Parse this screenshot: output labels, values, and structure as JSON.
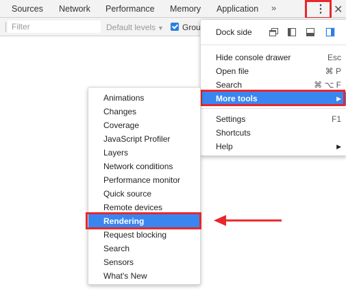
{
  "tabs": [
    {
      "label": "Sources"
    },
    {
      "label": "Network"
    },
    {
      "label": "Performance"
    },
    {
      "label": "Memory"
    },
    {
      "label": "Application"
    }
  ],
  "tab_overflow": "»",
  "kebab_glyph": "⋮",
  "close_glyph": "✕",
  "toolbar": {
    "filter_placeholder": "Filter",
    "filter_value": "",
    "levels_label": "Default levels",
    "levels_arrow": "▼",
    "group_label": "Grou",
    "group_checked": true
  },
  "menu": {
    "dock_side_label": "Dock side",
    "items": [
      {
        "label": "Hide console drawer",
        "shortcut": "Esc"
      },
      {
        "label": "Open file",
        "shortcut": "⌘ P"
      },
      {
        "label": "Search",
        "shortcut": "⌘ ⌥ F"
      },
      {
        "label": "More tools",
        "arrow": "▶"
      },
      {
        "label": "Settings",
        "shortcut": "F1"
      },
      {
        "label": "Shortcuts"
      },
      {
        "label": "Help",
        "arrow": "▶"
      }
    ]
  },
  "more_tools": [
    {
      "label": "Animations"
    },
    {
      "label": "Changes"
    },
    {
      "label": "Coverage"
    },
    {
      "label": "JavaScript Profiler"
    },
    {
      "label": "Layers"
    },
    {
      "label": "Network conditions"
    },
    {
      "label": "Performance monitor"
    },
    {
      "label": "Quick source"
    },
    {
      "label": "Remote devices"
    },
    {
      "label": "Rendering"
    },
    {
      "label": "Request blocking"
    },
    {
      "label": "Search"
    },
    {
      "label": "Sensors"
    },
    {
      "label": "What's New"
    }
  ],
  "colors": {
    "accent": "#3a86f0",
    "highlight": "#e8262a"
  },
  "icons": [
    "overflow-chevron-icon",
    "kebab-menu-icon",
    "close-icon",
    "dock-undock-icon",
    "dock-left-icon",
    "dock-bottom-icon",
    "dock-right-icon",
    "checkbox-checked-icon",
    "submenu-arrow-icon"
  ]
}
